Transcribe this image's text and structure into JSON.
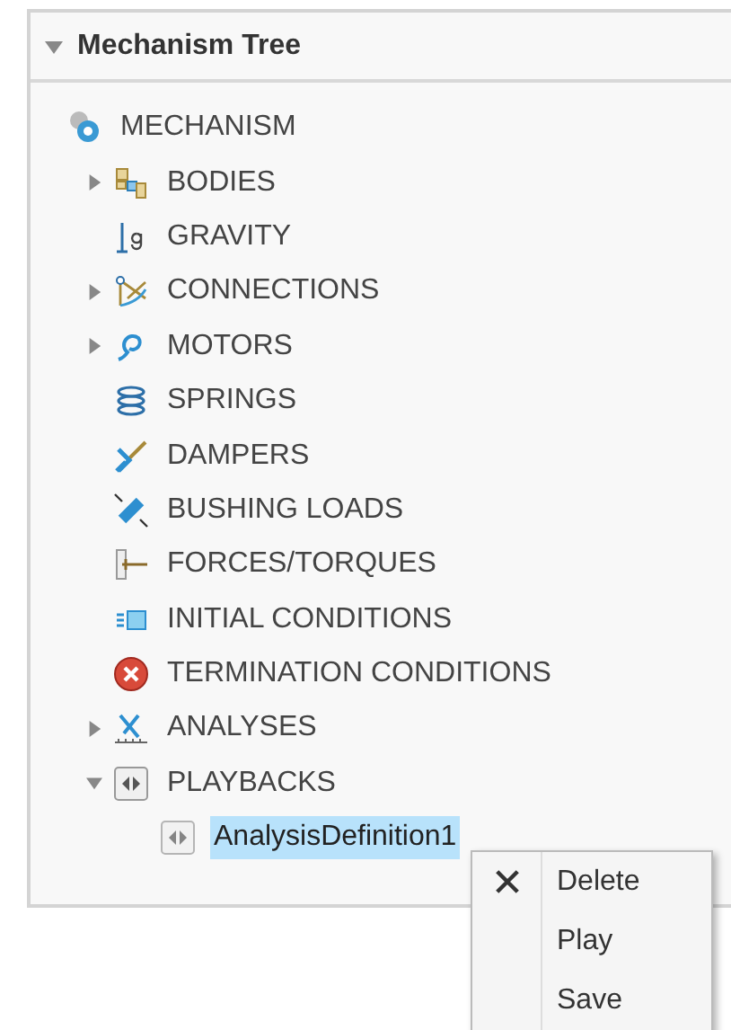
{
  "panel": {
    "title": "Mechanism Tree",
    "expanded": true
  },
  "tree": [
    {
      "label": "MECHANISM",
      "kind": "gear",
      "selected": false,
      "children": [
        {
          "label": "BODIES",
          "kind": "bodies",
          "selected": false,
          "expanded": false
        },
        {
          "label": "GRAVITY",
          "kind": "gravity",
          "selected": false
        },
        {
          "label": "CONNECTIONS",
          "kind": "connections",
          "selected": false,
          "expanded": false
        },
        {
          "label": "MOTORS",
          "kind": "motors",
          "selected": false,
          "expanded": false
        },
        {
          "label": "SPRINGS",
          "kind": "springs",
          "selected": false
        },
        {
          "label": "DAMPERS",
          "kind": "dampers",
          "selected": false
        },
        {
          "label": "BUSHING LOADS",
          "kind": "bushing",
          "selected": false
        },
        {
          "label": "FORCES/TORQUES",
          "kind": "forces",
          "selected": false
        },
        {
          "label": "INITIAL CONDITIONS",
          "kind": "initial",
          "selected": false
        },
        {
          "label": "TERMINATION CONDITIONS",
          "kind": "termination",
          "selected": false
        },
        {
          "label": "ANALYSES",
          "kind": "analyses",
          "selected": false,
          "expanded": false
        },
        {
          "label": "PLAYBACKS",
          "kind": "playbacks",
          "selected": false,
          "expanded": true,
          "children": [
            {
              "label": "AnalysisDefinition1",
              "kind": "playback",
              "selected": true
            }
          ]
        }
      ]
    }
  ],
  "context_menu": [
    {
      "label": "Delete",
      "kind": "delete"
    },
    {
      "label": "Play",
      "kind": "plain"
    },
    {
      "label": "Save",
      "kind": "plain"
    }
  ]
}
